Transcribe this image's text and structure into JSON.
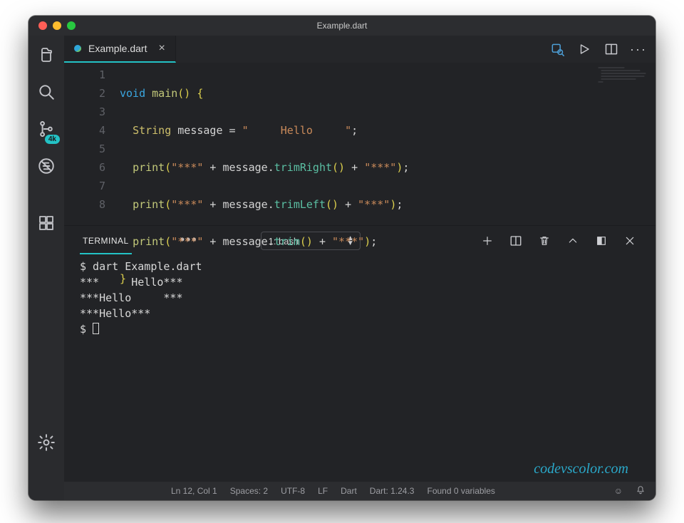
{
  "window": {
    "title": "Example.dart"
  },
  "traffic": {
    "close": "#ff5f57",
    "min": "#febc2e",
    "max": "#28c840"
  },
  "tab": {
    "label": "Example.dart"
  },
  "activity": {
    "badge": "4k"
  },
  "code": {
    "lines": [
      "1",
      "2",
      "3",
      "4",
      "5",
      "6",
      "7",
      "8"
    ],
    "l1_kw": "void",
    "l1_fn": "main",
    "l1_rest": "() ",
    "l2_type": "String",
    "l2_id": " message ",
    "l2_eq": "= ",
    "l2_str": "\"     Hello     \"",
    "l3_fn": "print",
    "l3_s1": "\"***\"",
    "l3_plus": " + ",
    "l3_msg": "message",
    "l3_dot": ".",
    "l3_m": "trimRight",
    "l3_par": "()",
    "l3_s2": "\"***\"",
    "l4_m": "trimLeft",
    "l5_m": "trim",
    "brace_o": "{",
    "brace_c": "}",
    "semi": ";"
  },
  "panel": {
    "tab": "TERMINAL",
    "select": "1: bash"
  },
  "terminal": {
    "l1": "$ dart Example.dart",
    "l2": "***     Hello***",
    "l3": "***Hello     ***",
    "l4": "***Hello***",
    "l5": "$ "
  },
  "status": {
    "pos": "Ln 12, Col 1",
    "spaces": "Spaces: 2",
    "enc": "UTF-8",
    "eol": "LF",
    "lang": "Dart",
    "sdk": "Dart: 1.24.3",
    "vars": "Found 0 variables"
  },
  "watermark": "codevscolor.com"
}
